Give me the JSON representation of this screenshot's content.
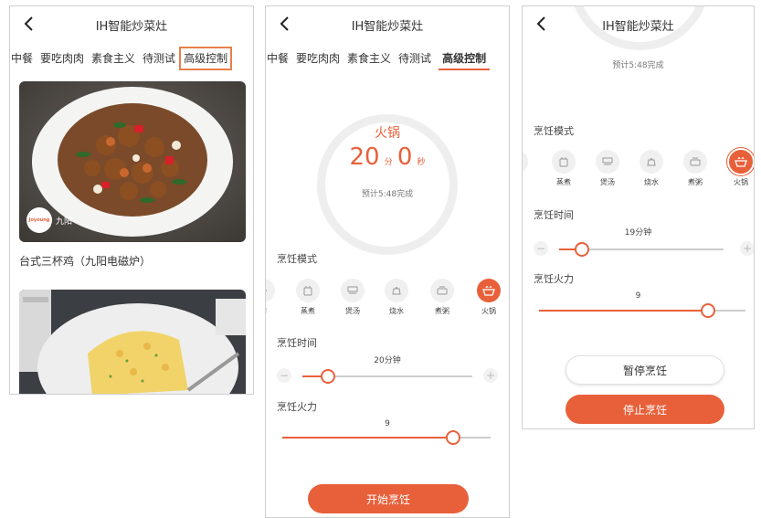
{
  "app": {
    "title": "IH智能炒菜灶"
  },
  "tabs": [
    "中餐",
    "要吃肉肉",
    "素食主义",
    "待测试",
    "高级控制"
  ],
  "recipe": {
    "name": "台式三杯鸡（九阳电磁炉）",
    "brand_logo_text": "Joyoung",
    "brand_name": "九阳"
  },
  "labels": {
    "mode": "烹饪模式",
    "time": "烹饪时间",
    "power": "烹饪火力"
  },
  "modes": [
    {
      "name": "炸",
      "icon": "fry-icon"
    },
    {
      "name": "蒸煮",
      "icon": "steam-icon"
    },
    {
      "name": "煲汤",
      "icon": "soup-pot-icon"
    },
    {
      "name": "烧水",
      "icon": "kettle-icon"
    },
    {
      "name": "煮粥",
      "icon": "porridge-icon"
    },
    {
      "name": "火锅",
      "icon": "hotpot-icon"
    }
  ],
  "screen2": {
    "mode_name": "火锅",
    "minutes": "20",
    "minute_unit": "分",
    "seconds": "0",
    "second_unit": "秒",
    "estimate": "预计5:48完成",
    "time_value": "20分钟",
    "time_fraction": 0.15,
    "power_value": "9",
    "power_fraction": 0.82,
    "start_button": "开始烹饪"
  },
  "screen3": {
    "estimate": "预计5:48完成",
    "time_value": "19分钟",
    "time_fraction": 0.14,
    "power_value": "9",
    "power_fraction": 0.82,
    "pause_button": "暂停烹饪",
    "stop_button": "停止烹饪"
  },
  "colors": {
    "accent": "#e8603a",
    "tab_box": "#e8804a",
    "track": "#cccccc"
  }
}
